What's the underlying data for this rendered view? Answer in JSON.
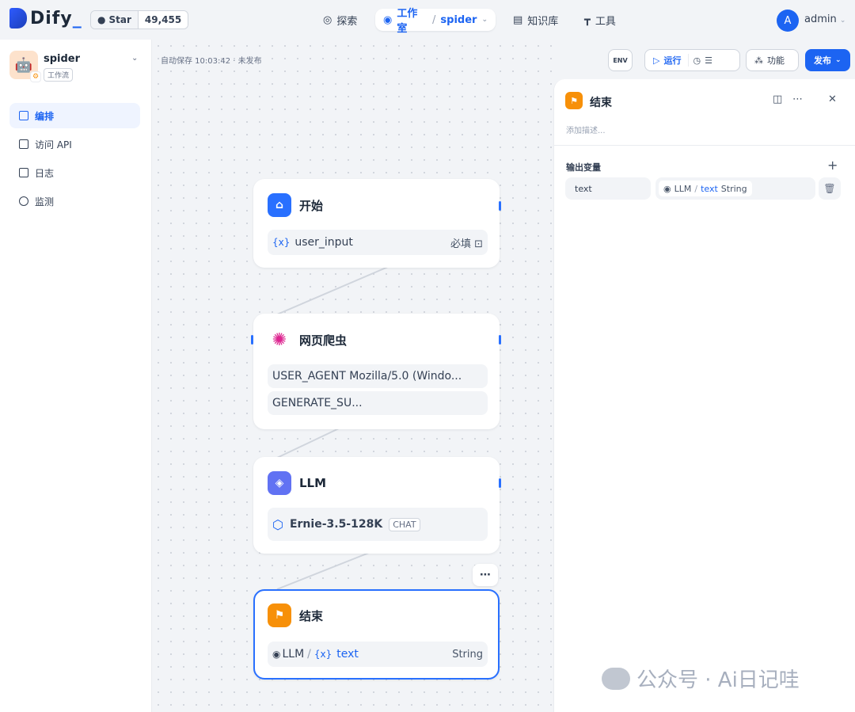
{
  "header": {
    "logo_text": "Dify",
    "github": {
      "star_label": "Star",
      "star_count": "49,455"
    },
    "nav": [
      {
        "label": "探索",
        "icon": "compass-icon"
      },
      {
        "label": "工作室",
        "icon": "robot-icon",
        "sub": "spider"
      },
      {
        "label": "知识库",
        "icon": "book-icon"
      },
      {
        "label": "工具",
        "icon": "hammer-icon"
      }
    ],
    "user": {
      "initial": "A",
      "name": "admin"
    }
  },
  "sidebar": {
    "app": {
      "name": "spider",
      "type": "工作流"
    },
    "items": [
      {
        "label": "编排",
        "active": true
      },
      {
        "label": "访问 API",
        "active": false
      },
      {
        "label": "日志",
        "active": false
      },
      {
        "label": "监测",
        "active": false
      }
    ]
  },
  "toolbar": {
    "autosave": "自动保存 10:03:42 · 未发布",
    "env_label": "ENV",
    "run_label": "运行",
    "features_label": "功能",
    "publish_label": "发布"
  },
  "nodes": {
    "start": {
      "title": "开始",
      "var_prefix": "{x}",
      "var_name": "user_input",
      "required": "必填"
    },
    "crawler": {
      "title": "网页爬虫",
      "params": [
        "USER_AGENT Mozilla/5.0 (Windo...",
        "GENERATE_SU..."
      ]
    },
    "llm": {
      "title": "LLM",
      "model": "Ernie-3.5-128K",
      "mode": "CHAT"
    },
    "end": {
      "title": "结束",
      "source": "LLM",
      "var_prefix": "{x}",
      "var": "text",
      "type": "String"
    }
  },
  "panel": {
    "title": "结束",
    "desc_placeholder": "添加描述...",
    "output_label": "输出变量",
    "var_name": "text",
    "source_node": "LLM",
    "source_var": "text",
    "source_type": "String"
  },
  "watermark": "公众号 · Ai日记哇",
  "colors": {
    "accent": "#1c64f2",
    "start": "#2970ff",
    "crawler": "#dd2590",
    "llm": "#6172f3",
    "end": "#f79009"
  }
}
